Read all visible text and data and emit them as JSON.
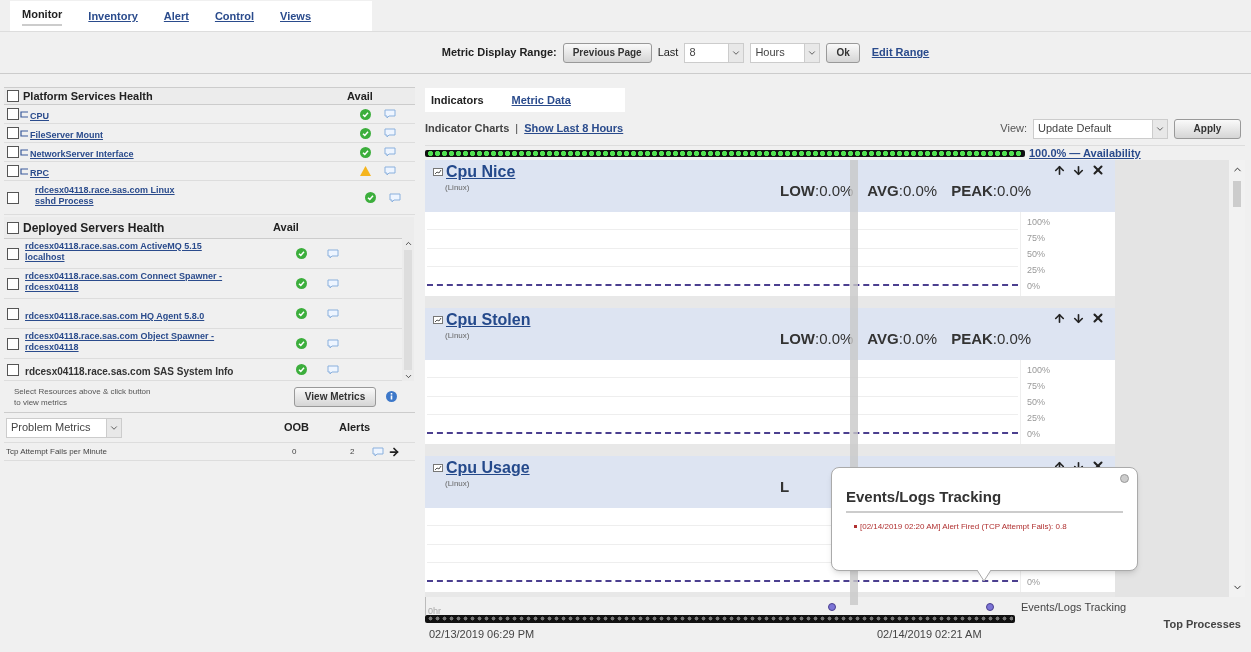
{
  "nav_tabs": [
    {
      "label": "Monitor",
      "selected": true
    },
    {
      "label": "Inventory",
      "selected": false
    },
    {
      "label": "Alert",
      "selected": false
    },
    {
      "label": "Control",
      "selected": false
    },
    {
      "label": "Views",
      "selected": false
    }
  ],
  "range_bar": {
    "label": "Metric Display Range:",
    "previous_button": "Previous Page",
    "last_label": "Last",
    "count_select": "8",
    "unit_select": "Hours",
    "ok_button": "Ok",
    "edit_link": "Edit Range"
  },
  "platform_services": {
    "title": "Platform Services Health",
    "avail_header": "Avail",
    "checked": false,
    "rows": [
      {
        "name": "CPU",
        "kind": "group",
        "warning": false,
        "checked": false
      },
      {
        "name": "FileServer Mount",
        "kind": "group",
        "warning": false,
        "checked": false
      },
      {
        "name": "NetworkServer Interface",
        "kind": "group",
        "warning": false,
        "checked": false
      },
      {
        "name": "RPC",
        "kind": "group",
        "warning": true,
        "checked": false
      },
      {
        "name": "rdcesx04118.race.sas.com Linux sshd Process",
        "kind": "resource",
        "warning": false,
        "checked": false
      }
    ]
  },
  "deployed_servers": {
    "title": "Deployed Servers Health",
    "avail_header": "Avail",
    "checked": false,
    "rows": [
      {
        "name": "rdcesx04118.race.sas.com ActiveMQ 5.15 localhost",
        "kind": "link",
        "warning": false,
        "checked": false
      },
      {
        "name": "rdcesx04118.race.sas.com Connect Spawner - rdcesx04118",
        "kind": "link",
        "warning": false,
        "checked": false
      },
      {
        "name": "rdcesx04118.race.sas.com HQ Agent 5.8.0",
        "kind": "link",
        "warning": false,
        "checked": false
      },
      {
        "name": "rdcesx04118.race.sas.com Object Spawner - rdcesx04118",
        "kind": "link",
        "warning": false,
        "checked": false
      },
      {
        "name": "rdcesx04118.race.sas.com SAS System Info",
        "kind": "plain",
        "warning": false,
        "checked": false
      }
    ]
  },
  "view_metrics": {
    "hint": "Select Resources above & click button to view metrics",
    "button": "View Metrics"
  },
  "problem_metrics": {
    "select": "Problem Metrics",
    "oob_header": "OOB",
    "alerts_header": "Alerts",
    "rows": [
      {
        "name": "Tcp Attempt Fails per Minute",
        "oob": "0",
        "alerts": "2"
      }
    ]
  },
  "right_tabs": [
    {
      "label": "Indicators",
      "selected": true
    },
    {
      "label": "Metric Data",
      "selected": false
    }
  ],
  "indicator_bar": {
    "title": "Indicator Charts",
    "separator": "|",
    "link": "Show Last 8 Hours",
    "view_label": "View:",
    "view_select": "Update Default",
    "apply_button": "Apply"
  },
  "availability": {
    "level": 1,
    "link": "100.0% — Availability"
  },
  "charts": [
    {
      "title": "Cpu Nice",
      "subtitle": "(Linux)",
      "stats": [
        "**LOW**:0.0%",
        "**AVG**:0.0%",
        "**PEAK**:0.0%"
      ],
      "y_ticks": [
        "100%",
        "75%",
        "50%",
        "25%",
        "0%"
      ]
    },
    {
      "title": "Cpu Stolen",
      "subtitle": "(Linux)",
      "stats": [
        "**LOW**:0.0%",
        "**AVG**:0.0%",
        "**PEAK**:0.0%"
      ],
      "y_ticks": [
        "100%",
        "75%",
        "50%",
        "25%",
        "0%"
      ]
    },
    {
      "title": "Cpu Usage",
      "subtitle": "(Linux)",
      "stats": [
        "**L**"
      ],
      "y_ticks": [
        "0%"
      ]
    }
  ],
  "timeline": {
    "start_label": "0hr",
    "events_label": "Events/Logs Tracking",
    "start_date": "02/13/2019 06:29 PM",
    "end_date": "02/14/2019 02:21 AM"
  },
  "popover": {
    "title": "Events/Logs Tracking",
    "items": [
      "[02/14/2019 02:20 AM] Alert Fired (TCP Attempt Fails): 0.8"
    ]
  },
  "top_processes": "Top Processes"
}
